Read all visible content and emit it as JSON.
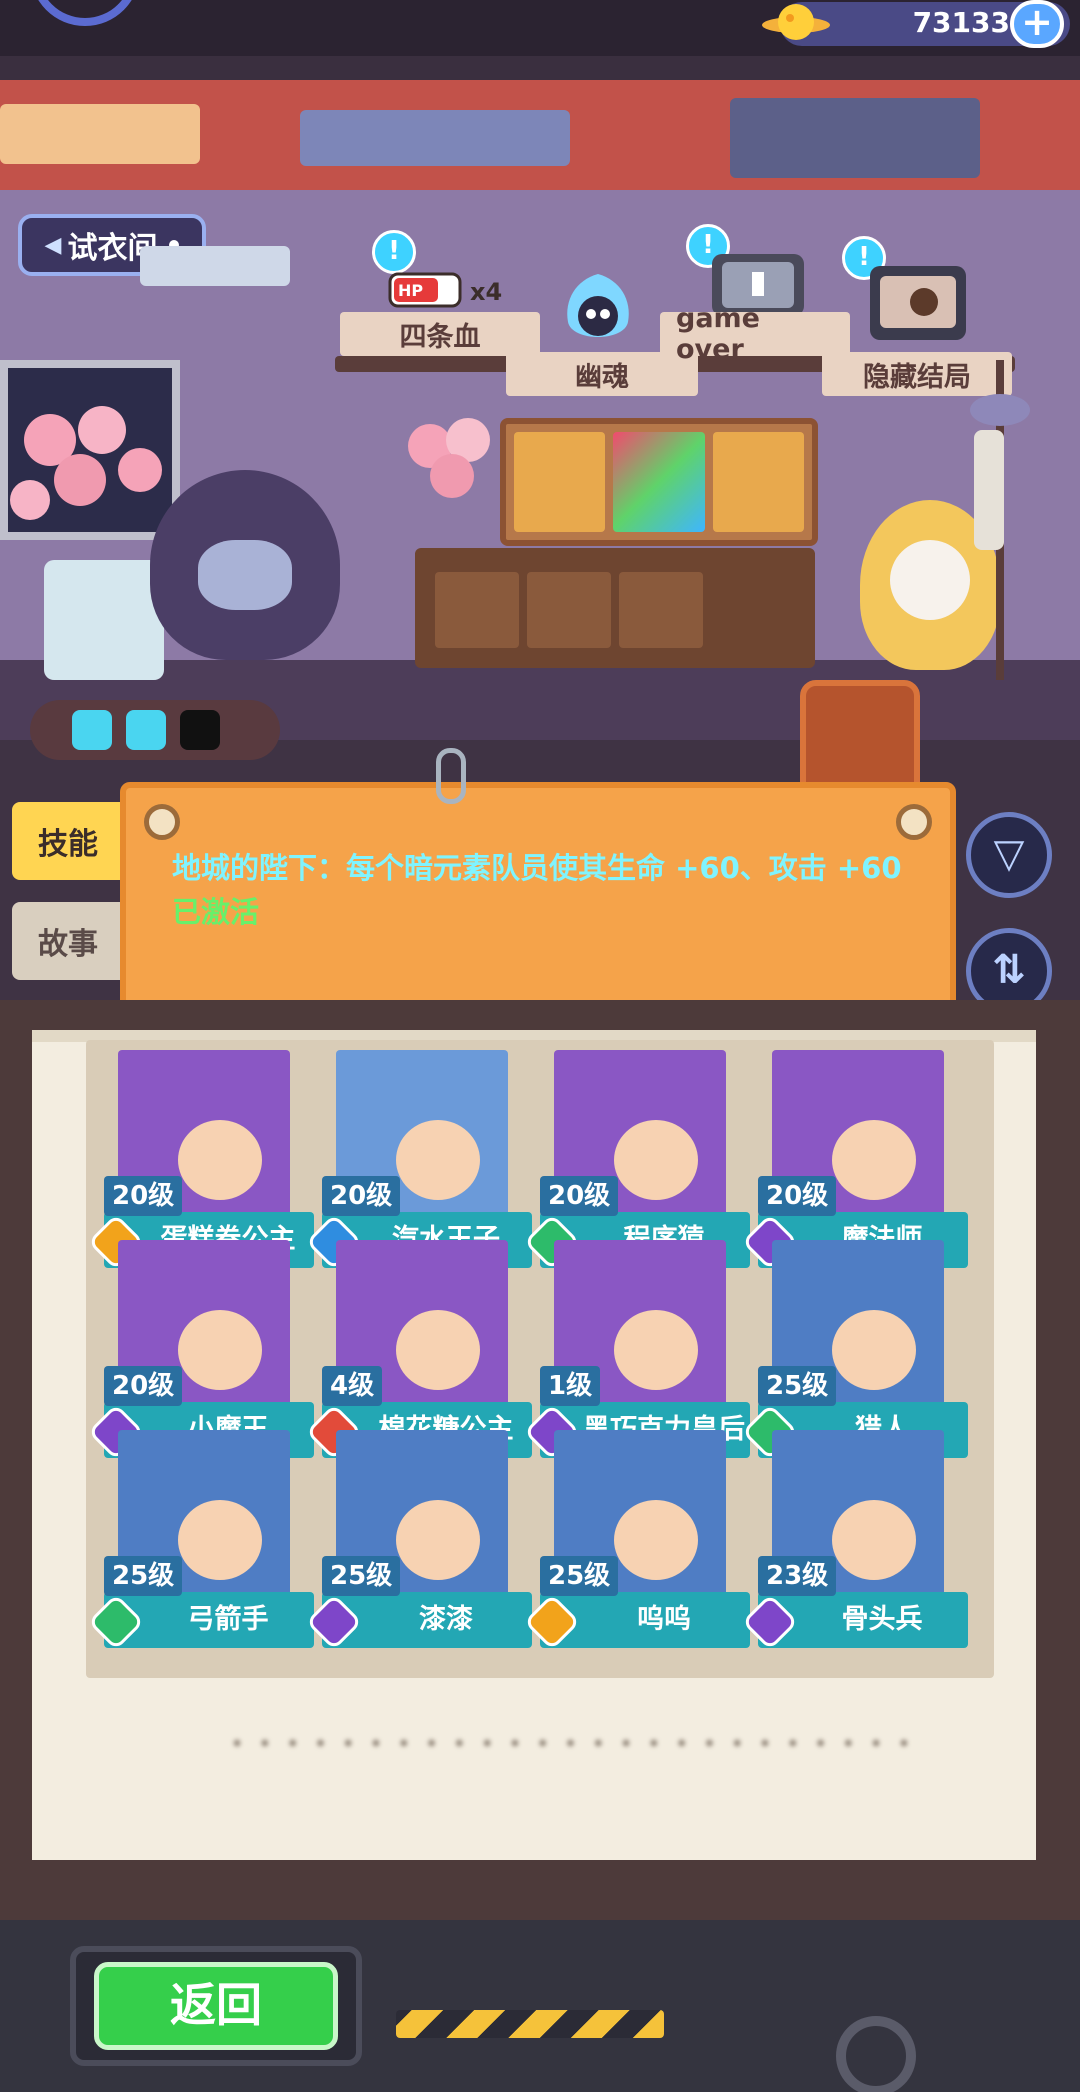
{
  "currency": {
    "icon": "planet-coin-icon",
    "amount": "73133"
  },
  "dressing_room": {
    "label": "试衣间"
  },
  "endings": [
    {
      "label": "四条血",
      "badge": "x4"
    },
    {
      "label": "幽魂"
    },
    {
      "label": "game over"
    },
    {
      "label": "隐藏结局"
    }
  ],
  "side_tabs": {
    "skill": "技能",
    "story": "故事"
  },
  "skill": {
    "text": "地城的陛下：每个暗元素队员使其生命 +60、攻击 +60",
    "status": "已激活"
  },
  "heroes": [
    {
      "level": "20级",
      "name": "蛋糕卷公主",
      "gem_color": "#f2a31b",
      "bg": "#8a57c4"
    },
    {
      "level": "20级",
      "name": "汽水王子",
      "gem_color": "#2f8de0",
      "bg": "#6b9ad9"
    },
    {
      "level": "20级",
      "name": "程序猿",
      "gem_color": "#2dbb6a",
      "bg": "#8a57c4"
    },
    {
      "level": "20级",
      "name": "魔法师",
      "gem_color": "#7e46c9",
      "bg": "#8a57c4"
    },
    {
      "level": "20级",
      "name": "小魔王",
      "gem_color": "#7e46c9",
      "bg": "#8a57c4"
    },
    {
      "level": "4级",
      "name": "棉花糖公主",
      "gem_color": "#e24b3a",
      "bg": "#8a57c4"
    },
    {
      "level": "1级",
      "name": "黑巧克力皇后",
      "gem_color": "#7e46c9",
      "bg": "#8a57c4"
    },
    {
      "level": "25级",
      "name": "猎人",
      "gem_color": "#2dbb6a",
      "bg": "#4f7dc4"
    },
    {
      "level": "25级",
      "name": "弓箭手",
      "gem_color": "#2dbb6a",
      "bg": "#4f7dc4"
    },
    {
      "level": "25级",
      "name": "漆漆",
      "gem_color": "#7e46c9",
      "bg": "#4f7dc4"
    },
    {
      "level": "25级",
      "name": "呜呜",
      "gem_color": "#f2a31b",
      "bg": "#4f7dc4"
    },
    {
      "level": "23级",
      "name": "骨头兵",
      "gem_color": "#7e46c9",
      "bg": "#4f7dc4"
    }
  ],
  "back_button": {
    "label": "返回"
  }
}
